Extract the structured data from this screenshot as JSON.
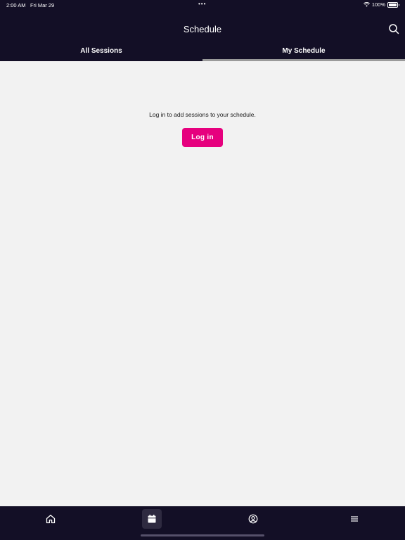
{
  "status_bar": {
    "time": "2:00 AM",
    "date": "Fri Mar 29",
    "dots": "•••",
    "battery": "100%"
  },
  "header": {
    "title": "Schedule",
    "search_icon": "search-icon"
  },
  "tabs": [
    {
      "label": "All Sessions",
      "selected": false
    },
    {
      "label": "My Schedule",
      "selected": true
    }
  ],
  "content": {
    "message": "Log in to add sessions to your schedule.",
    "login_label": "Log in"
  },
  "bottom_nav": [
    {
      "icon": "home-icon",
      "selected": false
    },
    {
      "icon": "calendar-icon",
      "selected": true
    },
    {
      "icon": "profile-icon",
      "selected": false
    },
    {
      "icon": "menu-icon",
      "selected": false
    }
  ],
  "colors": {
    "bar_bg": "#130f26",
    "accent": "#e6007e",
    "page_bg": "#f2f2f2"
  }
}
